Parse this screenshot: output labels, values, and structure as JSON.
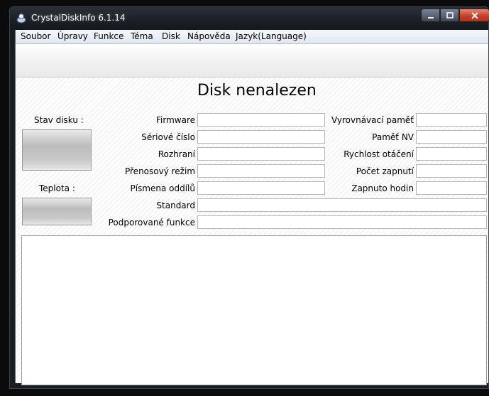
{
  "window": {
    "title": "CrystalDiskInfo 6.1.14",
    "app_icon": "crystaldiskinfo-icon",
    "buttons": {
      "minimize": "minimize-icon",
      "maximize": "maximize-icon",
      "close": "close-icon"
    }
  },
  "menu": [
    "Soubor",
    "Úpravy",
    "Funkce",
    "Téma",
    "Disk",
    "Nápověda",
    "Jazyk(Language)"
  ],
  "main": {
    "title": "Disk nenalezen",
    "health_label": "Stav disku :",
    "temperature_label": "Teplota :"
  },
  "fields": {
    "firmware": {
      "label": "Firmware",
      "value": ""
    },
    "serial": {
      "label": "Sériové číslo",
      "value": ""
    },
    "interface": {
      "label": "Rozhraní",
      "value": ""
    },
    "transfer_mode": {
      "label": "Přenosový režim",
      "value": ""
    },
    "drive_letters": {
      "label": "Písmena oddílů",
      "value": ""
    },
    "standard": {
      "label": "Standard",
      "value": ""
    },
    "features": {
      "label": "Podporované funkce",
      "value": ""
    },
    "buffer": {
      "label": "Vyrovnávací paměť",
      "value": ""
    },
    "nv_cache": {
      "label": "Paměť NV",
      "value": ""
    },
    "rotation": {
      "label": "Rychlost otáčení",
      "value": ""
    },
    "power_on_count": {
      "label": "Počet zapnutí",
      "value": ""
    },
    "power_on_hours": {
      "label": "Zapnuto hodin",
      "value": ""
    }
  },
  "colors": {
    "close_button": "#c4402a",
    "titlebar": "#1c2026"
  }
}
